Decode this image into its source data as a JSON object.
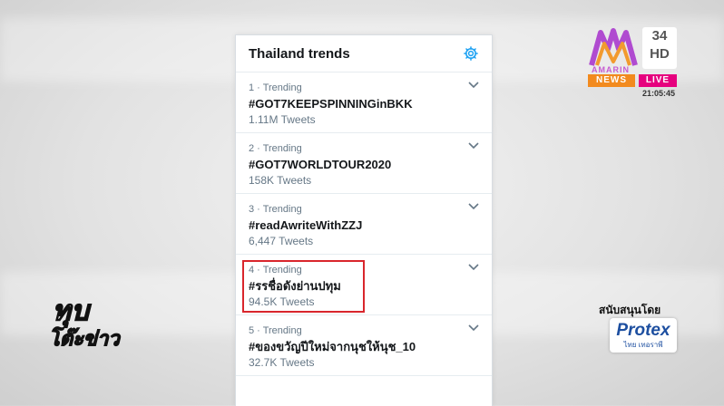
{
  "panel": {
    "title": "Thailand trends",
    "gear_icon": "gear-icon"
  },
  "trends": [
    {
      "meta": "1 · Trending",
      "name": "#GOT7KEEPSPINNINGinBKK",
      "count": "1.11M Tweets"
    },
    {
      "meta": "2 · Trending",
      "name": "#GOT7WORLDTOUR2020",
      "count": "158K Tweets"
    },
    {
      "meta": "3 · Trending",
      "name": "#readAwriteWithZZJ",
      "count": "6,447 Tweets"
    },
    {
      "meta": "4 · Trending",
      "name": "#รรชื่อดังย่านปทุม",
      "count": "94.5K Tweets"
    },
    {
      "meta": "5 · Trending",
      "name": "#ของขวัญปีใหม่จากนุชให้นุช_10",
      "count": "32.7K Tweets"
    }
  ],
  "channel": {
    "brand": "AMARIN",
    "number": "34",
    "hd": "HD",
    "news": "NEWS",
    "live": "LIVE",
    "clock": "21:05:45"
  },
  "show": {
    "line1": "ทุบ",
    "line2": "โต๊ะข่าว"
  },
  "sponsor": {
    "label": "สนับสนุนโดย",
    "name": "Protex",
    "sub": "ไทย เทอราพี"
  },
  "colors": {
    "highlight": "#d9262c",
    "accent": "#1da1f2",
    "news": "#f28a1e",
    "live": "#e6007e"
  }
}
